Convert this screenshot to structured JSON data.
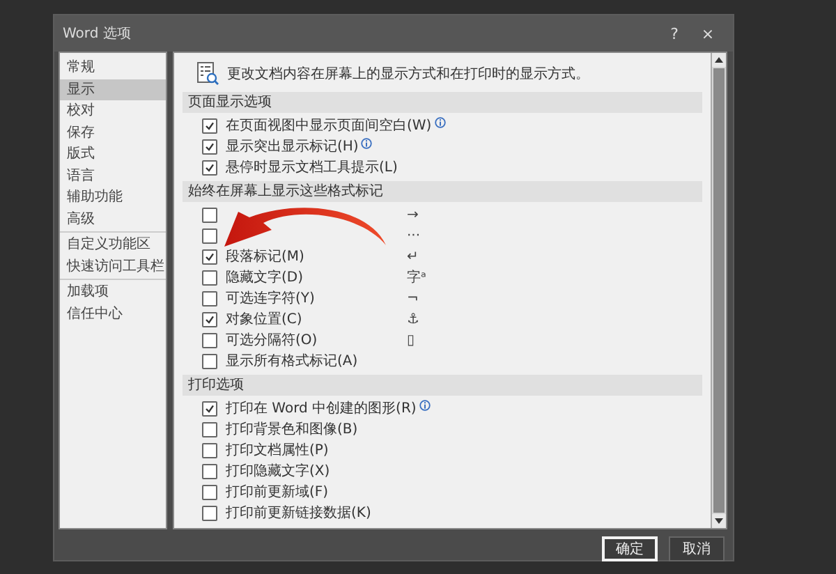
{
  "window": {
    "title": "Word 选项",
    "help": "?",
    "close": "×"
  },
  "sidebar": {
    "groups": [
      {
        "items": [
          {
            "label": "常规",
            "selected": false
          },
          {
            "label": "显示",
            "selected": true
          },
          {
            "label": "校对",
            "selected": false
          },
          {
            "label": "保存",
            "selected": false
          },
          {
            "label": "版式",
            "selected": false
          },
          {
            "label": "语言",
            "selected": false
          },
          {
            "label": "辅助功能",
            "selected": false
          },
          {
            "label": "高级",
            "selected": false
          }
        ]
      },
      {
        "items": [
          {
            "label": "自定义功能区",
            "selected": false
          },
          {
            "label": "快速访问工具栏",
            "selected": false
          }
        ]
      },
      {
        "items": [
          {
            "label": "加载项",
            "selected": false
          },
          {
            "label": "信任中心",
            "selected": false
          }
        ]
      }
    ]
  },
  "intro": "更改文档内容在屏幕上的显示方式和在打印时的显示方式。",
  "sections": [
    {
      "title": "页面显示选项",
      "items": [
        {
          "label": "在页面视图中显示页面间空白(W)",
          "checked": true,
          "info": true
        },
        {
          "label": "显示突出显示标记(H)",
          "checked": true,
          "info": true
        },
        {
          "label": "悬停时显示文档工具提示(L)",
          "checked": true,
          "info": false
        }
      ]
    },
    {
      "title": "始终在屏幕上显示这些格式标记",
      "items": [
        {
          "checked": false,
          "info": false,
          "symbol": "→"
        },
        {
          "checked": false,
          "info": false,
          "symbol": "···"
        },
        {
          "label": "段落标记(M)",
          "checked": true,
          "info": false,
          "symbol": "↵"
        },
        {
          "label": "隐藏文字(D)",
          "checked": false,
          "info": false,
          "symbol": "字ᵃ"
        },
        {
          "label": "可选连字符(Y)",
          "checked": false,
          "info": false,
          "symbol": "¬"
        },
        {
          "label": "对象位置(C)",
          "checked": true,
          "info": false,
          "symbol": "⚓"
        },
        {
          "label": "可选分隔符(O)",
          "checked": false,
          "info": false,
          "symbol": "▯"
        },
        {
          "label": "显示所有格式标记(A)",
          "checked": false,
          "info": false
        }
      ]
    },
    {
      "title": "打印选项",
      "items": [
        {
          "label": "打印在 Word 中创建的图形(R)",
          "checked": true,
          "info": true
        },
        {
          "label": "打印背景色和图像(B)",
          "checked": false,
          "info": false
        },
        {
          "label": "打印文档属性(P)",
          "checked": false,
          "info": false
        },
        {
          "label": "打印隐藏文字(X)",
          "checked": false,
          "info": false
        },
        {
          "label": "打印前更新域(F)",
          "checked": false,
          "info": false
        },
        {
          "label": "打印前更新链接数据(K)",
          "checked": false,
          "info": false
        }
      ]
    }
  ],
  "buttons": [
    {
      "label": "确定",
      "default": true
    },
    {
      "label": "取消",
      "default": false
    }
  ]
}
